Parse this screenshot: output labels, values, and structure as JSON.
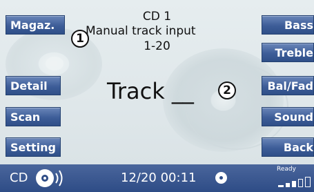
{
  "left_buttons": [
    {
      "label": "Magaz."
    },
    {
      "label": "Detail"
    },
    {
      "label": "Scan"
    },
    {
      "label": "Setting"
    }
  ],
  "right_buttons": [
    {
      "label": "Bass"
    },
    {
      "label": "Treble"
    },
    {
      "label": "Bal/Fad"
    },
    {
      "label": "Sound"
    },
    {
      "label": "Back"
    }
  ],
  "main": {
    "source_title": "CD 1",
    "mode_title": "Manual track input",
    "range": "1-20",
    "track_label": "Track __",
    "callout_1": "1",
    "callout_2": "2"
  },
  "status_bar": {
    "source": "CD",
    "track_time": "12/20  00:11",
    "ready": "Ready",
    "source_icon": "cd-disc-icon",
    "disc_indicator_icon": "disc-indicator-icon",
    "signal_icon": "signal-strength-icon"
  },
  "colors": {
    "button_blue": "#3d5d98",
    "status_bar_blue": "#2e4c86",
    "background": "#dfe7ea"
  }
}
